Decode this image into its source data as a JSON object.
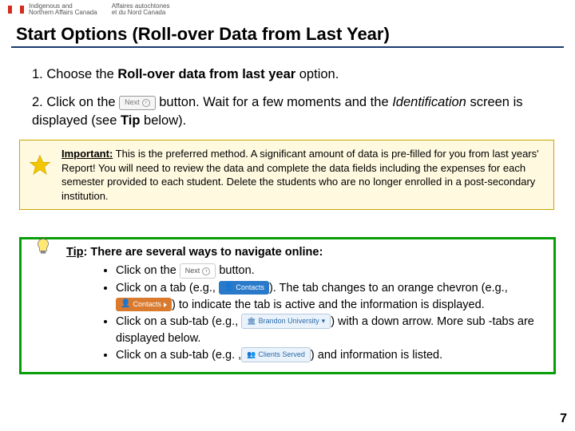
{
  "gov": {
    "col1a": "Indigenous and",
    "col1b": "Northern Affairs Canada",
    "col2a": "Affaires autochtones",
    "col2b": "et du Nord Canada"
  },
  "title": "Start Options (Roll-over Data from Last Year)",
  "step1": {
    "num": "1. ",
    "pre": "Choose the ",
    "bold": "Roll-over data from last year",
    "post": " option."
  },
  "step2": {
    "num": "2. ",
    "pre": "Click on the ",
    "btn": "Next",
    "post1": " button. Wait for a few moments and the ",
    "ital": "Identification",
    "post2": " screen is displayed (see ",
    "bold": "Tip",
    "post3": " below)."
  },
  "important": {
    "label": "Important:",
    "text": " This is the preferred method. A significant amount of data is pre-filled for you from last years' Report!  You will need to review the data and complete the data fields including the expenses for each semester provided to each student. Delete the students who are no longer enrolled in a post-secondary institution."
  },
  "tip": {
    "label": "Tip",
    "intro": ": There are several ways to navigate online:",
    "li1_a": "Click on the ",
    "li1_btn": "Next",
    "li1_b": " button.",
    "li2_a": "Click on a tab (e.g., ",
    "li2_chip1": "Contacts",
    "li2_b": "). The tab changes to an orange chevron (e.g., ",
    "li2_chip2": "Contacts",
    "li2_c": ") to indicate the tab is active and the information is displayed.",
    "li3_a": "Click on a sub-tab (e.g., ",
    "li3_chip": "Brandon University",
    "li3_b": ") with a down arrow. More sub -tabs are displayed below.",
    "li4_a": "Click on a sub-tab (e.g. ,",
    "li4_chip": "Clients Served",
    "li4_b": ") and information is listed."
  },
  "page": "7"
}
